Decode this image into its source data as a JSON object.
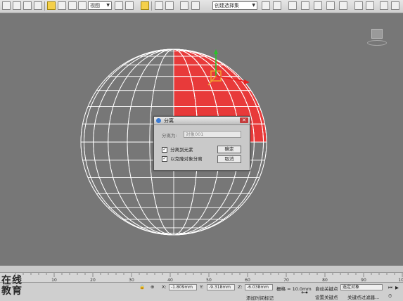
{
  "toolbar": {
    "selection_filter": "视图",
    "named_selection": "创建选择集"
  },
  "dialog": {
    "title": "分离",
    "name_label": "分离为:",
    "name_value": "对象001",
    "checkbox1": {
      "label": "分离到元素",
      "checked": true
    },
    "checkbox2": {
      "label": "以克隆对象分离",
      "checked": true
    },
    "ok_label": "确定",
    "cancel_label": "取消"
  },
  "ruler": {
    "ticks": [
      "0",
      "10",
      "20",
      "30",
      "40",
      "50",
      "60",
      "70",
      "80",
      "90",
      "100"
    ]
  },
  "status": {
    "x_label": "X:",
    "x_value": "-1.809mm",
    "y_label": "Y:",
    "y_value": "-9.318mm",
    "z_label": "Z:",
    "z_value": "-6.038mm",
    "grid_label": "栅格 = 10.0mm",
    "auto_key_label": "自动关键点",
    "selected_value": "选定对象",
    "set_key_label": "设置关键点",
    "key_filters_label": "关键点过滤器...",
    "add_time_tag": "添加时间标记"
  },
  "watermark": {
    "line1": "在线",
    "line2": "教育"
  },
  "colors": {
    "viewport_bg": "#777777",
    "wireframe": "#ffffff",
    "selection_red": "#e83a3a",
    "gizmo_orange": "#f0a030"
  }
}
